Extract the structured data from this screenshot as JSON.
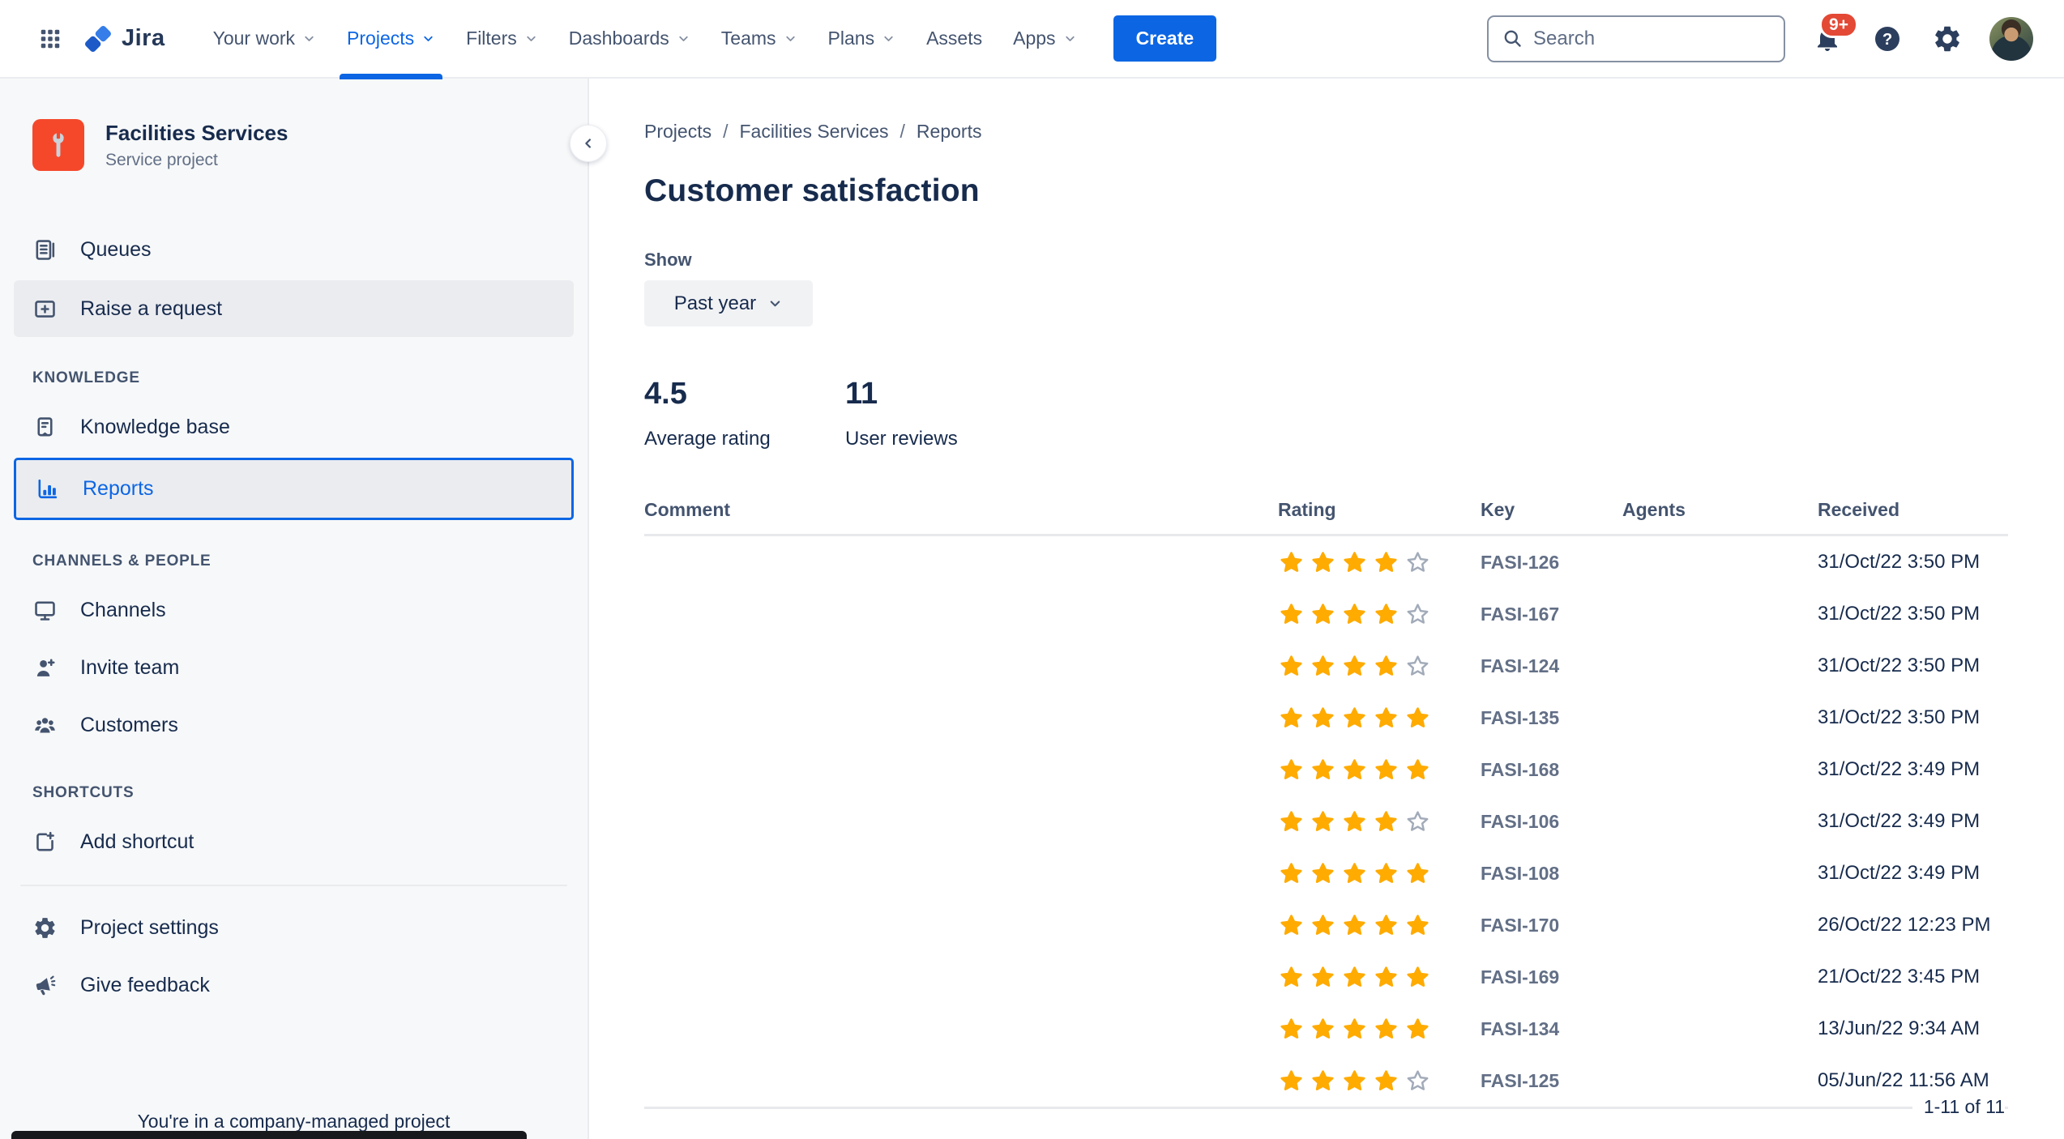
{
  "header": {
    "logo_text": "Jira",
    "nav": [
      {
        "label": "Your work",
        "chevron": true,
        "active": false
      },
      {
        "label": "Projects",
        "chevron": true,
        "active": true
      },
      {
        "label": "Filters",
        "chevron": true,
        "active": false
      },
      {
        "label": "Dashboards",
        "chevron": true,
        "active": false
      },
      {
        "label": "Teams",
        "chevron": true,
        "active": false
      },
      {
        "label": "Plans",
        "chevron": true,
        "active": false
      },
      {
        "label": "Assets",
        "chevron": false,
        "active": false
      },
      {
        "label": "Apps",
        "chevron": true,
        "active": false
      }
    ],
    "create_label": "Create",
    "search_placeholder": "Search",
    "notifications_badge": "9+"
  },
  "sidebar": {
    "project": {
      "name": "Facilities Services",
      "type": "Service project"
    },
    "nav": [
      {
        "type": "item",
        "label": "Queues",
        "icon": "queues-icon",
        "state": "normal"
      },
      {
        "type": "item",
        "label": "Raise a request",
        "icon": "raise-request-icon",
        "state": "highlighted"
      },
      {
        "type": "heading",
        "label": "KNOWLEDGE"
      },
      {
        "type": "item",
        "label": "Knowledge base",
        "icon": "knowledge-base-icon",
        "state": "normal"
      },
      {
        "type": "item",
        "label": "Reports",
        "icon": "reports-icon",
        "state": "selected"
      },
      {
        "type": "heading",
        "label": "CHANNELS & PEOPLE"
      },
      {
        "type": "item",
        "label": "Channels",
        "icon": "channels-icon",
        "state": "normal"
      },
      {
        "type": "item",
        "label": "Invite team",
        "icon": "invite-team-icon",
        "state": "normal"
      },
      {
        "type": "item",
        "label": "Customers",
        "icon": "customers-icon",
        "state": "normal"
      },
      {
        "type": "heading",
        "label": "SHORTCUTS"
      },
      {
        "type": "item",
        "label": "Add shortcut",
        "icon": "add-shortcut-icon",
        "state": "normal"
      },
      {
        "type": "divider"
      },
      {
        "type": "item",
        "label": "Project settings",
        "icon": "settings-icon",
        "state": "normal"
      },
      {
        "type": "item",
        "label": "Give feedback",
        "icon": "megaphone-icon",
        "state": "normal"
      }
    ],
    "footer_note": "You're in a company-managed project"
  },
  "main": {
    "breadcrumb": [
      "Projects",
      "Facilities Services",
      "Reports"
    ],
    "title": "Customer satisfaction",
    "show_label": "Show",
    "period_selector": "Past year",
    "stats": [
      {
        "value": "4.5",
        "label": "Average rating"
      },
      {
        "value": "11",
        "label": "User reviews"
      }
    ],
    "table": {
      "columns": [
        "Comment",
        "Rating",
        "Key",
        "Agents",
        "Received"
      ],
      "rows": [
        {
          "comment": "",
          "rating": 4,
          "key": "FASI-126",
          "agents": "",
          "received": "31/Oct/22 3:50 PM"
        },
        {
          "comment": "",
          "rating": 4,
          "key": "FASI-167",
          "agents": "",
          "received": "31/Oct/22 3:50 PM"
        },
        {
          "comment": "",
          "rating": 4,
          "key": "FASI-124",
          "agents": "",
          "received": "31/Oct/22 3:50 PM"
        },
        {
          "comment": "",
          "rating": 5,
          "key": "FASI-135",
          "agents": "",
          "received": "31/Oct/22 3:50 PM"
        },
        {
          "comment": "",
          "rating": 5,
          "key": "FASI-168",
          "agents": "",
          "received": "31/Oct/22 3:49 PM"
        },
        {
          "comment": "",
          "rating": 4,
          "key": "FASI-106",
          "agents": "",
          "received": "31/Oct/22 3:49 PM"
        },
        {
          "comment": "",
          "rating": 5,
          "key": "FASI-108",
          "agents": "",
          "received": "31/Oct/22 3:49 PM"
        },
        {
          "comment": "",
          "rating": 5,
          "key": "FASI-170",
          "agents": "",
          "received": "26/Oct/22 12:23 PM"
        },
        {
          "comment": "",
          "rating": 5,
          "key": "FASI-169",
          "agents": "",
          "received": "21/Oct/22 3:45 PM"
        },
        {
          "comment": "",
          "rating": 5,
          "key": "FASI-134",
          "agents": "",
          "received": "13/Jun/22 9:34 AM"
        },
        {
          "comment": "",
          "rating": 4,
          "key": "FASI-125",
          "agents": "",
          "received": "05/Jun/22 11:56 AM"
        }
      ],
      "max_rating": 5,
      "pagination": "1-11 of 11"
    }
  },
  "colors": {
    "accent_blue": "#0C66E4",
    "star_filled": "#FFAB00",
    "star_empty": "#A2ABB9",
    "badge_red": "#E34935",
    "project_icon_bg": "#F5482B",
    "text_primary": "#172B4D",
    "text_secondary": "#44546F",
    "text_muted": "#626F86"
  }
}
